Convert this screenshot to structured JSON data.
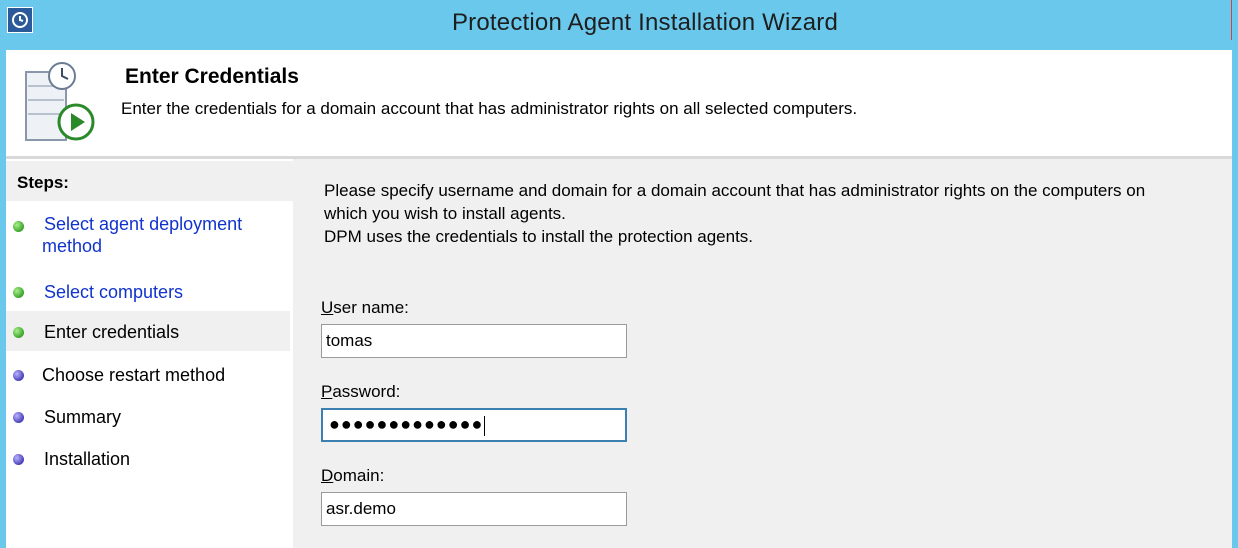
{
  "window": {
    "title": "Protection Agent Installation Wizard"
  },
  "header": {
    "title": "Enter Credentials",
    "subtitle": "Enter the credentials for a domain account that has administrator rights on all selected computers."
  },
  "steps": {
    "heading": "Steps:",
    "items": [
      {
        "label": "Select agent deployment",
        "label2": "method",
        "status": "complete",
        "link": true
      },
      {
        "label": "Select computers",
        "status": "complete",
        "link": true
      },
      {
        "label": "Enter credentials",
        "status": "current",
        "link": false
      },
      {
        "label": "Choose restart method",
        "status": "pending",
        "link": false
      },
      {
        "label": "Summary",
        "status": "pending",
        "link": false
      },
      {
        "label": "Installation",
        "status": "pending",
        "link": false
      }
    ]
  },
  "form": {
    "intro_line1": "Please specify username and domain for a domain account that has administrator rights on the computers on",
    "intro_line2": "which you wish to install agents.",
    "intro_line3": "DPM uses the credentials to install the protection agents.",
    "username": {
      "label_key": "U",
      "label_rest": "ser name:",
      "value": "tomas"
    },
    "password": {
      "label_key": "P",
      "label_rest": "assword:",
      "masked": "●●●●●●●●●●●●●"
    },
    "domain": {
      "label_key": "D",
      "label_rest": "omain:",
      "value": "asr.demo"
    }
  },
  "colors": {
    "titlebar": "#6ac8ec",
    "link": "#1133cc",
    "complete_dot": "#3aa32a",
    "pending_dot": "#4a40b8"
  }
}
